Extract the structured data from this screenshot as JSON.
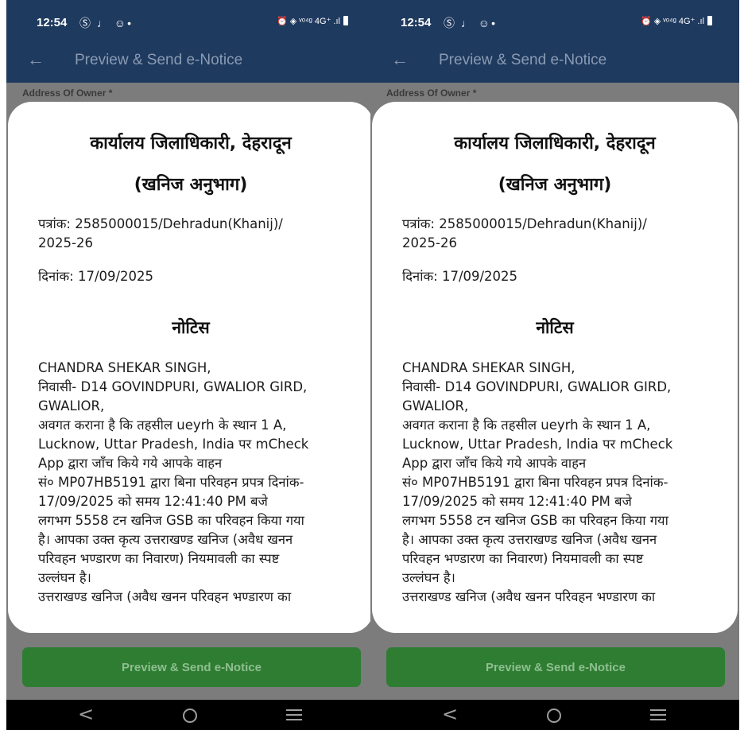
{
  "status_bar": {
    "time": "12:54",
    "left_icons": "Ⓢ ♩ ☺•",
    "right_icons": "⏰ ◈ ᵛᵒ⁴ᵍ 4G⁺ .ıl"
  },
  "app_bar": {
    "title": "Preview & Send e-Notice"
  },
  "form_behind": {
    "label": "Address Of Owner *"
  },
  "notice": {
    "office_title": "कार्यालय जिलाधिकारी, देहरादून",
    "section_title": "(खनिज अनुभाग)",
    "ref_line1": "पत्रांक: 2585000015/Dehradun(Khanij)/",
    "ref_line2": "2025-26",
    "date_line": "दिनांक: 17/09/2025",
    "notice_heading": "नोटिस",
    "body_lines": [
      "CHANDRA SHEKAR SINGH,",
      "निवासी- D14 GOVINDPURI, GWALIOR GIRD,",
      "GWALIOR,",
      "अवगत कराना है कि तहसील ueyrh के स्थान 1 A,",
      "Lucknow, Uttar Pradesh, India पर mCheck",
      "App द्वारा जाँच किये गये आपके वाहन",
      "सं० MP07HB5191 द्वारा बिना परिवहन प्रपत्र दिनांक-",
      " 17/09/2025 को समय 12:41:40 PM बजे",
      "लगभग 5558 टन खनिज GSB का परिवहन किया गया",
      "है। आपका उक्त कृत्य उत्तराखण्ड खनिज (अवैध खनन",
      "परिवहन भण्डारण का निवारण) नियमावली का स्पष्ट",
      "उल्लंघन है।",
      "उत्तराखण्ड खनिज (अवैध खनन परिवहन भण्डारण का"
    ]
  },
  "actions": {
    "send_label": "Preview & Send e-Notice"
  },
  "nav": {
    "back": "<"
  },
  "colors": {
    "app_bar": "#1f3a5f",
    "button": "#2e7d32",
    "overlay": "#7c7c7c"
  }
}
